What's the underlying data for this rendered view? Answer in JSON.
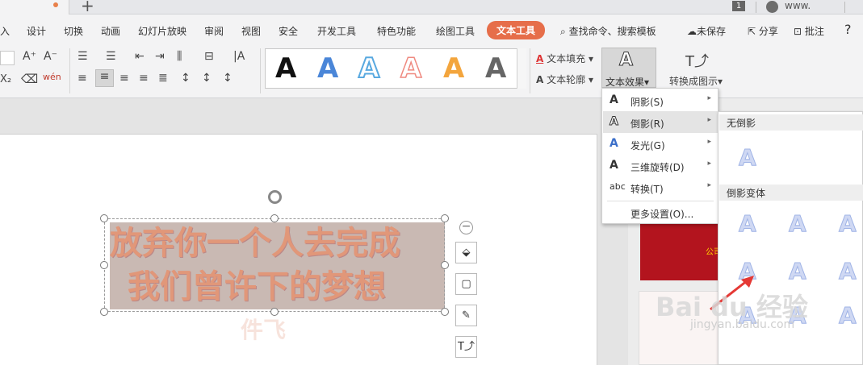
{
  "topbar": {
    "new_tab": "+",
    "badge": "1",
    "user": "www."
  },
  "menu_tabs": [
    "入",
    "设计",
    "切换",
    "动画",
    "幻灯片放映",
    "审阅",
    "视图",
    "安全",
    "开发工具",
    "特色功能",
    "绘图工具",
    "文本工具"
  ],
  "search": {
    "label": "查找命令、搜索模板"
  },
  "right_actions": {
    "unsaved": "未保存",
    "share": "分享",
    "comment": "批注",
    "help": "?"
  },
  "ribbon": {
    "font_inc": "A⁺",
    "font_dec": "A⁻",
    "pinyin": "wén",
    "text_fill": "文本填充",
    "text_outline": "文本轮廓",
    "text_effect": "文本效果",
    "convert": "转换成图示"
  },
  "gallery": {
    "glyph": "A",
    "colors": [
      "#111111",
      "#4a86d8",
      "#59a9e0",
      "#ef8a80",
      "#f3a53d",
      "#666666"
    ]
  },
  "slide": {
    "line1": "放弃你一个人去完成",
    "line2": "我们曾许下的梦想",
    "reflection": "件飞"
  },
  "effects_menu": {
    "items": [
      {
        "icon": "A",
        "label": "阴影(S)",
        "arrow": "▸"
      },
      {
        "icon": "A",
        "label": "倒影(R)",
        "arrow": "▸"
      },
      {
        "icon": "A",
        "label": "发光(G)",
        "arrow": "▸"
      },
      {
        "icon": "A",
        "label": "三维旋转(D)",
        "arrow": "▸"
      },
      {
        "icon": "abc",
        "label": "转换(T)",
        "arrow": "▸"
      },
      {
        "icon": "",
        "label": "更多设置(O)...",
        "arrow": ""
      }
    ]
  },
  "reflection_sub": {
    "none_header": "无倒影",
    "variant_header": "倒影变体",
    "glyph": "A"
  },
  "thumb": {
    "text": "公司"
  },
  "watermark": {
    "brand": "Bai du 经验",
    "url": "jingyan.baidu.com"
  }
}
